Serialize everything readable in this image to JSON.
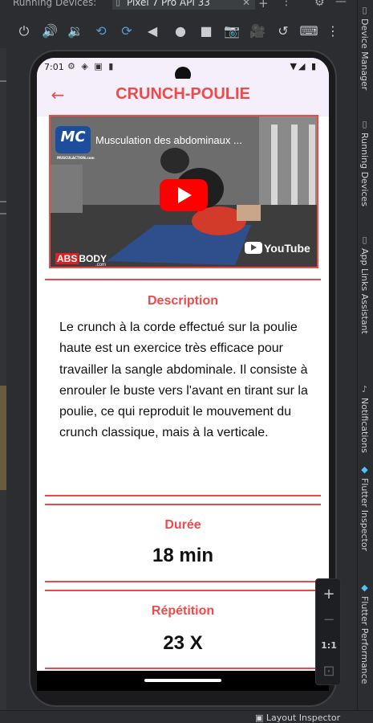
{
  "ide": {
    "running_devices_label": "Running Devices:",
    "device_tab_label": "Pixel 7 Pro API 33",
    "tab_close": "✕",
    "add_device": "+",
    "more": "⋮",
    "settings": "⚙",
    "minimize": "—",
    "right_tools": [
      {
        "label": "Device Manager",
        "icon": "device-manager-icon"
      },
      {
        "label": "Running Devices",
        "icon": "running-devices-icon"
      },
      {
        "label": "App Links Assistant",
        "icon": "app-links-icon"
      },
      {
        "label": "Notifications",
        "icon": "bell-icon"
      },
      {
        "label": "Flutter Inspector",
        "icon": "flutter-icon"
      },
      {
        "label": "Flutter Performance",
        "icon": "flutter-icon"
      }
    ],
    "bottom_tool": "Layout Inspector",
    "emulator_controls": [
      {
        "name": "power",
        "glyph": "⏻"
      },
      {
        "name": "volume-up",
        "glyph": "🔊"
      },
      {
        "name": "volume-down",
        "glyph": "🔉"
      },
      {
        "name": "rotate-left",
        "glyph": "⟲"
      },
      {
        "name": "rotate-right",
        "glyph": "⟳"
      },
      {
        "name": "back",
        "glyph": "◀"
      },
      {
        "name": "home",
        "glyph": "●"
      },
      {
        "name": "overview",
        "glyph": "■"
      },
      {
        "name": "screenshot",
        "glyph": "📷"
      },
      {
        "name": "screen-record",
        "glyph": "🎥"
      },
      {
        "name": "snapshot",
        "glyph": "↺"
      },
      {
        "name": "keyboard",
        "glyph": "⌨"
      },
      {
        "name": "more",
        "glyph": "⋮"
      }
    ],
    "zoom": {
      "in": "+",
      "out": "−",
      "actual": "1:1",
      "fit": "⊡"
    }
  },
  "device": {
    "status_time": "7:01",
    "status_icons_left": "⚙ ◈ ▣ ▮",
    "status_icons_right": "▼◢ ▮"
  },
  "app": {
    "back_icon": "←",
    "title": "CRUNCH-POULIE",
    "video": {
      "title": "Musculation des abdominaux ...",
      "channel_logo": "MC",
      "channel_logo_sub": "MUSCULACTION.com",
      "youtube_label": "YouTube",
      "watermark_abs": "ABS",
      "watermark_body": "BODY",
      "watermark_com": ".com"
    },
    "description_label": "Description",
    "description_text": "Le crunch à la corde effectué sur la poulie haute est un exercice très efficace pour travailler la sangle abdominale. Il consiste à enrouler le buste vers l'avant en tirant sur la poulie, ce qui reproduit le mouvement du crunch classique, mais à la verticale.",
    "duration_label": "Durée",
    "duration_value": "18 min",
    "repetition_label": "Répétition",
    "repetition_value": "23 X"
  },
  "colors": {
    "accent": "#ef4a4a",
    "appbar_bg": "#f4effa",
    "ide_bg": "#2b2d30"
  }
}
